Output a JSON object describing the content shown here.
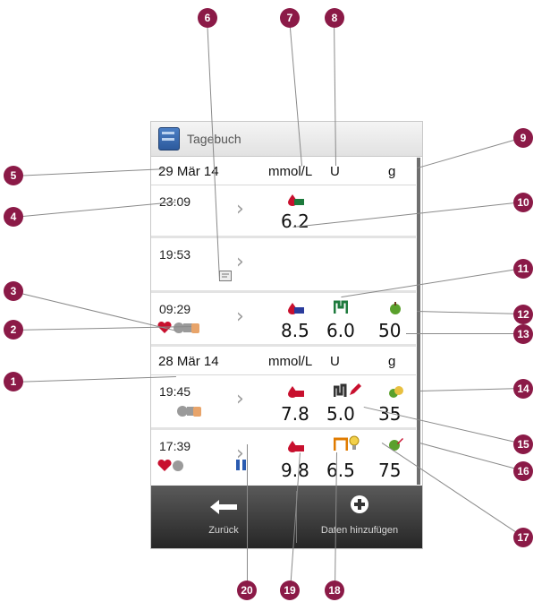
{
  "screen": {
    "title": "Tagebuch",
    "header1": {
      "date": "29 Mär 14",
      "unit_bg": "mmol/L",
      "unit_insulin": "U",
      "unit_carbs": "g"
    },
    "entries1": [
      {
        "time": "23:09",
        "bg": "6.2"
      },
      {
        "time": "19:53"
      },
      {
        "time": "09:29",
        "bg": "8.5",
        "insulin": "6.0",
        "carbs": "50"
      }
    ],
    "header2": {
      "date": "28 Mär 14",
      "unit_bg": "mmol/L",
      "unit_insulin": "U",
      "unit_carbs": "g"
    },
    "entries2": [
      {
        "time": "19:45",
        "bg": "7.8",
        "insulin": "5.0",
        "carbs": "35"
      },
      {
        "time": "17:39",
        "bg": "9.8",
        "insulin": "6.5",
        "carbs": "75"
      }
    ],
    "back_label": "Zurück",
    "add_label": "Daten hinzufügen"
  },
  "callouts": [
    "1",
    "2",
    "3",
    "4",
    "5",
    "6",
    "7",
    "8",
    "9",
    "10",
    "11",
    "12",
    "13",
    "14",
    "15",
    "16",
    "17",
    "18",
    "19",
    "20"
  ],
  "colors": {
    "badge": "#8b1a47",
    "bg_drop": "#c8102e",
    "insulin_basal": "#2e8b57",
    "insulin_bolus": "#e07b00",
    "carbs": "#5aa02c"
  }
}
